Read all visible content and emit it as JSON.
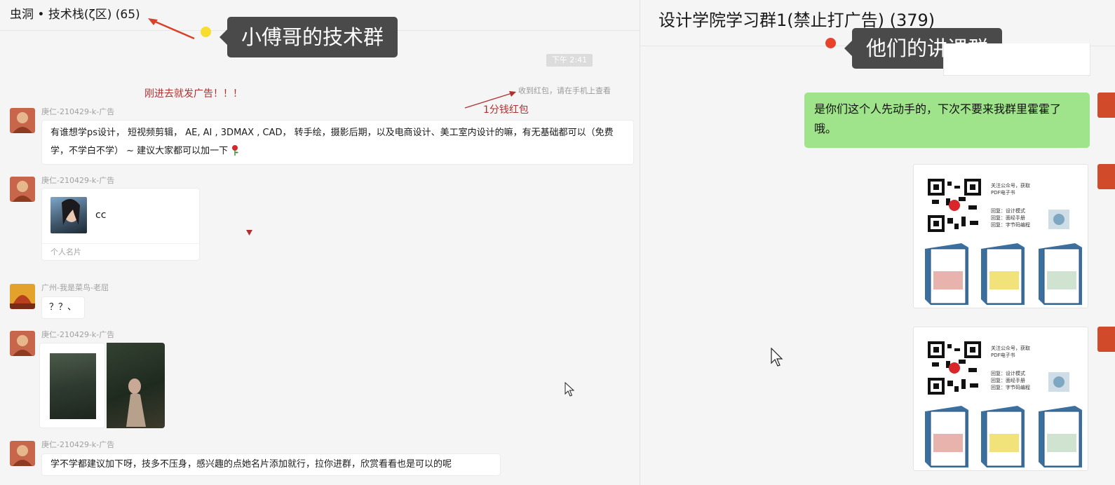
{
  "left": {
    "title": "虫洞 • 技术栈(ζ区) (65)",
    "callout": "小傅哥的技术群",
    "time": "下午 2:41",
    "annotation_ad": "刚进去就发广告！！！",
    "annotation_redpacket": "1分钱红包",
    "redpacket_notice": "收到红包，请在手机上查看",
    "messages": [
      {
        "sender": "庚仁-210429-k-广告",
        "text": "有谁想学ps设计，  短视频剪辑，  AE, AI , 3DMAX , CAD，  转手绘，摄影后期，以及电商设计、美工室内设计的嘛，有无基础都可以（免费学，不学白不学）  ~ 建议大家都可以加一下"
      },
      {
        "sender": "庚仁-210429-k-广告",
        "card_name": "cc",
        "card_label": "个人名片"
      },
      {
        "sender": "广州-我是菜鸟-老屈",
        "text": "？？、"
      },
      {
        "sender": "庚仁-210429-k-广告"
      },
      {
        "sender": "庚仁-210429-k-广告",
        "text": "学不学都建议加下呀，技多不压身，感兴趣的点她名片添加就行，拉你进群，欣赏看看也是可以的呢"
      }
    ]
  },
  "right": {
    "title": "设计学院学习群1(禁止打广告) (379)",
    "callout": "他们的讲课群",
    "reply": "是你们这个人先动手的，下次不要来我群里霍霍了哦。",
    "poster": {
      "lines": [
        "关注公众号，获取",
        "PDF电子书",
        "回复：设计模式",
        "回复：面经手册",
        "回复：字节码编程"
      ]
    }
  },
  "colors": {
    "callout_bg": "#4a4a4a",
    "yellow_dot": "#f6dd2e",
    "red_dot": "#e8432a",
    "green_bubble": "#9fe38a",
    "annotation_red": "#b03030"
  }
}
